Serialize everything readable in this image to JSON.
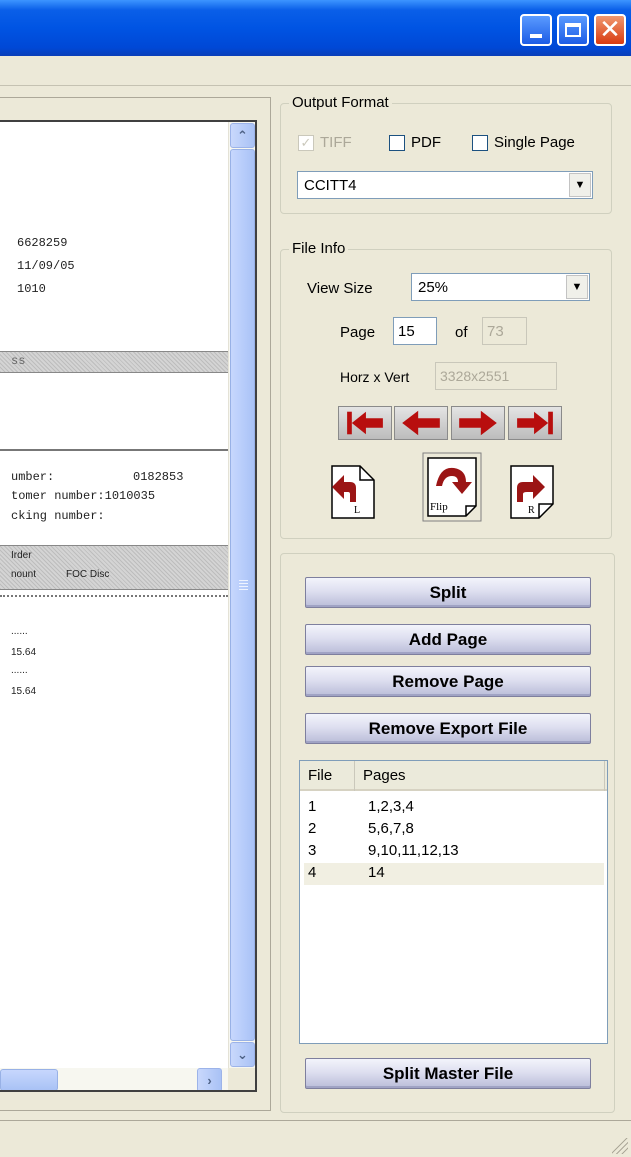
{
  "window": {
    "minimize_icon": "minimize-icon",
    "maximize_icon": "maximize-icon",
    "close_icon": "close-icon",
    "close_glyph": "✕"
  },
  "document": {
    "lines": [
      "6628259",
      "11/09/05",
      "1010",
      "ss",
      "umber:",
      "0182853",
      "tomer number:1010035",
      "cking number:",
      "Irder",
      "nount",
      "FOC Disc",
      "......",
      "15.64",
      "......",
      "15.64"
    ]
  },
  "scrollbar": {
    "up_glyph": "⌃",
    "down_glyph": "⌄",
    "right_glyph": "›"
  },
  "output_format": {
    "legend": "Output Format",
    "tiff_label": "TIFF",
    "tiff_checked": true,
    "pdf_label": "PDF",
    "pdf_checked": false,
    "single_page_label": "Single Page",
    "single_page_checked": false,
    "compression_value": "CCITT4",
    "dropdown_glyph": "▼",
    "check_glyph": "✓"
  },
  "file_info": {
    "legend": "File Info",
    "view_size_label": "View Size",
    "view_size_value": "25%",
    "page_label": "Page",
    "page_value": "15",
    "of_label": "of",
    "page_total": "73",
    "horz_vert_label": "Horz x Vert",
    "horz_vert_value": "3328x2551",
    "rotate_left_text": "L",
    "flip_text": "Flip",
    "rotate_right_text": "R"
  },
  "actions": {
    "split": "Split",
    "add_page": "Add Page",
    "remove_page": "Remove Page",
    "remove_export_file": "Remove Export File",
    "split_master_file": "Split Master File"
  },
  "file_list": {
    "columns": [
      "File",
      "Pages"
    ],
    "rows": [
      {
        "file": "1",
        "pages": "1,2,3,4"
      },
      {
        "file": "2",
        "pages": "5,6,7,8"
      },
      {
        "file": "3",
        "pages": "9,10,11,12,13"
      },
      {
        "file": "4",
        "pages": "14"
      }
    ]
  },
  "colors": {
    "titlebar": "#0054e3",
    "arrow_red": "#b80e0e",
    "window_bg": "#ece9d8"
  }
}
